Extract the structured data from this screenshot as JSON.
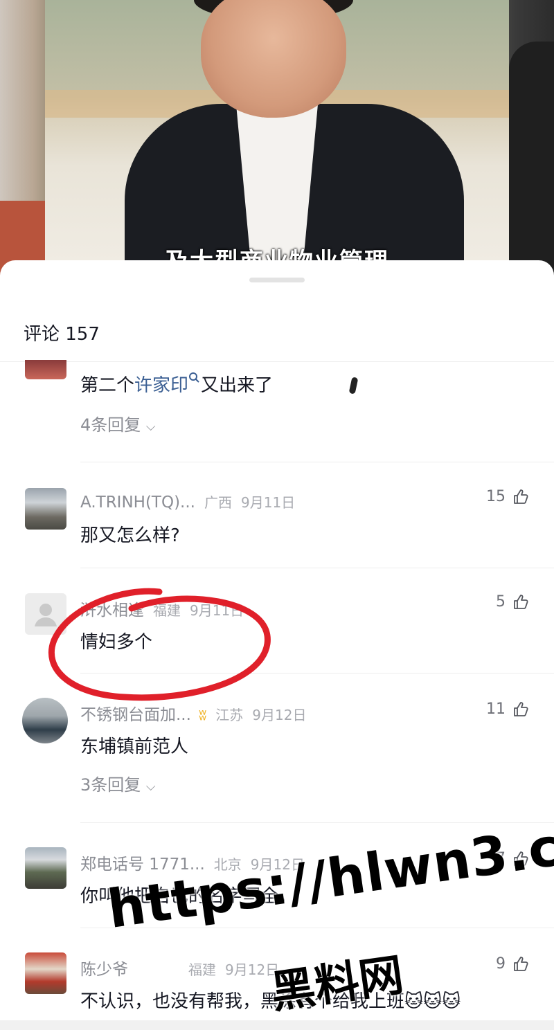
{
  "video": {
    "subtitle": "及大型商业物业管理"
  },
  "comments_panel": {
    "title": "评论 157",
    "comments": [
      {
        "body_prefix": "第二个",
        "body_link": "许家印",
        "body_suffix": "又出来了",
        "replies": "4条回复"
      },
      {
        "name": "A.TRINH(TQ)...",
        "location": "广西",
        "date": "9月11日",
        "likes": "15",
        "body": "那又怎么样?"
      },
      {
        "name": "浒水相逢",
        "location": "福建",
        "date": "9月11日",
        "likes": "5",
        "body": "情妇多个"
      },
      {
        "name": "不锈钢台面加...",
        "location": "江苏",
        "date": "9月12日",
        "likes": "11",
        "body": "东埔镇前范人",
        "replies": "3条回复"
      },
      {
        "name": "郑电话号 1771...",
        "location": "北京",
        "date": "9月12日",
        "likes": "7",
        "body": "你叫他把自己的名字写全。"
      },
      {
        "name": "陈少爷",
        "location": "福建",
        "date": "9月12日",
        "likes": "9",
        "body": "不认识，也没有帮我，黑涂有个给我上班🐱🐱🐱"
      }
    ]
  },
  "watermark": {
    "url": "https://hlwn3.com",
    "text": "黑料网"
  },
  "colors": {
    "annotation_red": "#e0202a",
    "link_blue": "#3b5f93",
    "meta_gray": "#a8aab0"
  }
}
